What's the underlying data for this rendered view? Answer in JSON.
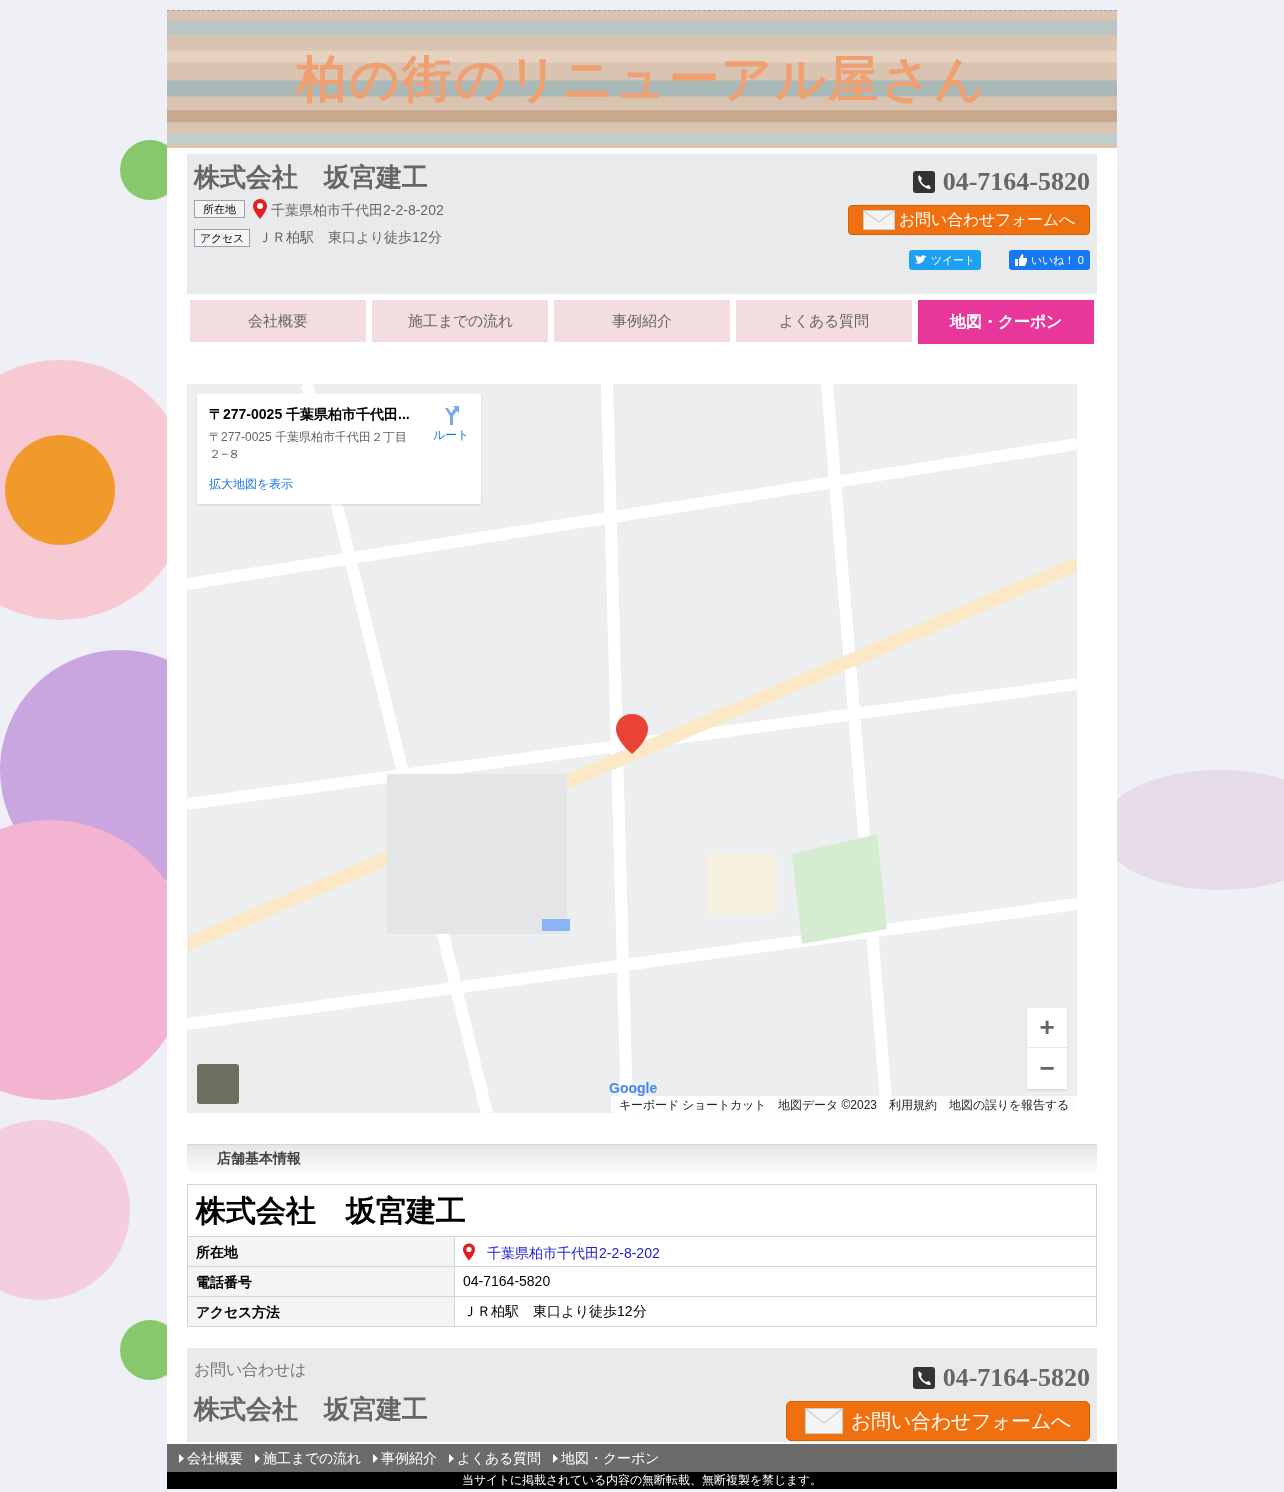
{
  "banner": {
    "title": "柏の街のリニューアル屋さん"
  },
  "header": {
    "company": "株式会社　坂宮建工",
    "address_label": "所在地",
    "address": "千葉県柏市千代田2-2-8-202",
    "access_label": "アクセス",
    "access": "ＪＲ柏駅　東口より徒歩12分",
    "phone": "04-7164-5820",
    "contact_button": "お問い合わせフォームへ",
    "tweet": "ツイート",
    "like": "いいね！ 0"
  },
  "nav": [
    {
      "label": "会社概要",
      "selected": false
    },
    {
      "label": "施工までの流れ",
      "selected": false
    },
    {
      "label": "事例紹介",
      "selected": false
    },
    {
      "label": "よくある質問",
      "selected": false
    },
    {
      "label": "地図・クーポン",
      "selected": true
    }
  ],
  "map": {
    "card_title": "〒277-0025 千葉県柏市千代田...",
    "card_address": "〒277-0025 千葉県柏市千代田２丁目２−８",
    "route": "ルート",
    "larger_map": "拡大地図を表示",
    "zoom_in": "+",
    "zoom_out": "−",
    "logo": "Google",
    "attribution": [
      "キーボード ショートカット",
      "地図データ ©2023",
      "利用規約",
      "地図の誤りを報告する"
    ]
  },
  "info": {
    "heading": "店舗基本情報",
    "company": "株式会社　坂宮建工",
    "rows": [
      {
        "label": "所在地",
        "value": "千葉県柏市千代田2-2-8-202",
        "kind": "link"
      },
      {
        "label": "電話番号",
        "value": "04-7164-5820",
        "kind": "text"
      },
      {
        "label": "アクセス方法",
        "value": "ＪＲ柏駅　東口より徒歩12分",
        "kind": "text"
      }
    ]
  },
  "contact": {
    "lead": "お問い合わせは",
    "company": "株式会社　坂宮建工",
    "phone": "04-7164-5820",
    "button": "お問い合わせフォームへ"
  },
  "footer_nav": [
    "会社概要",
    "施工までの流れ",
    "事例紹介",
    "よくある質問",
    "地図・クーポン"
  ],
  "copyright": "当サイトに掲載されている内容の無断転載、無断複製を禁じます。"
}
